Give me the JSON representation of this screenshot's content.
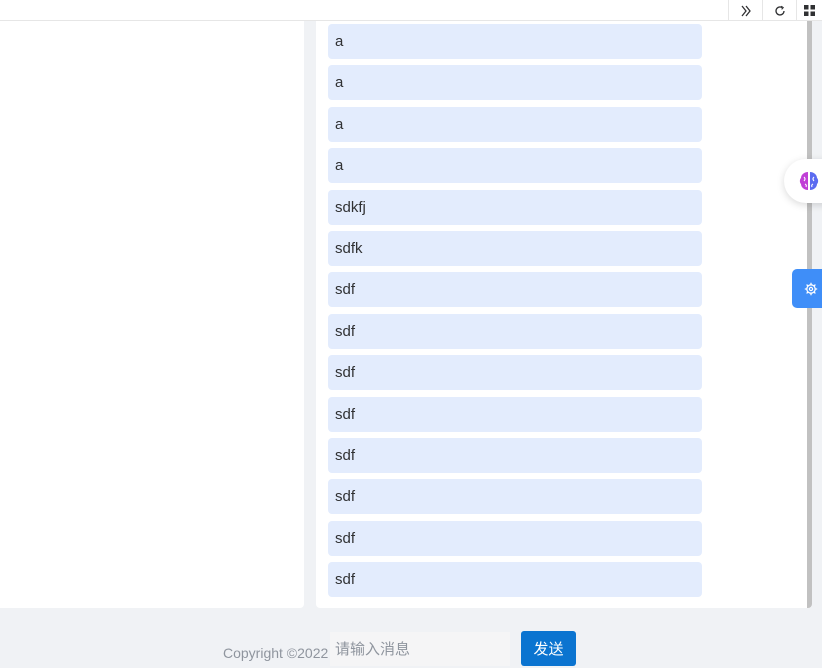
{
  "topbar": {
    "icons": [
      "double-chevron-right-icon",
      "refresh-icon",
      "grid-icon"
    ]
  },
  "chat": {
    "messages": [
      "a",
      "a",
      "a",
      "a",
      "sdkfj",
      "sdfk",
      "sdf",
      "sdf",
      "sdf",
      "sdf",
      "sdf",
      "sdf",
      "sdf",
      "sdf"
    ]
  },
  "floating": {
    "brain_icon": "brain-icon",
    "settings_icon": "gear-icon",
    "settings_color": "#3f8ef8"
  },
  "footer": {
    "copyright": "Copyright ©2022"
  },
  "composer": {
    "placeholder": "请输入消息",
    "value": "",
    "send_label": "发送",
    "send_color": "#0b74d0"
  },
  "colors": {
    "message_bubble": "#e3ecfd",
    "page_background": "#f0f2f5"
  }
}
